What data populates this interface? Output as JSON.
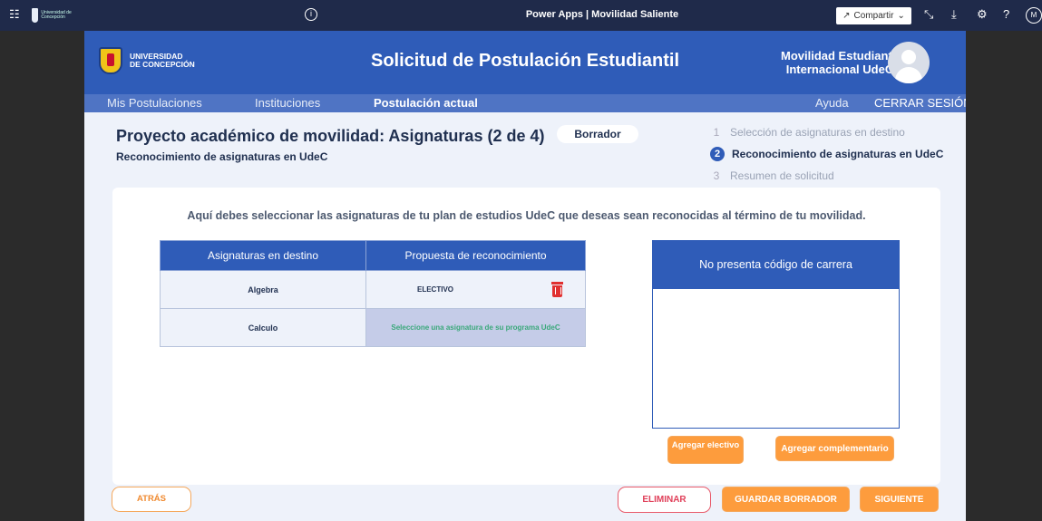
{
  "powerapps_bar": {
    "logo_text": "Universidad de Concepción",
    "title": "Power Apps | Movilidad Saliente",
    "share_label": "Compartir",
    "avatar_initial": "M"
  },
  "header": {
    "logo_line1": "UNIVERSIDAD",
    "logo_line2": "DE CONCEPCIÓN",
    "title": "Solicitud de Postulación Estudiantil",
    "subtitle_line1": "Movilidad Estudiantil",
    "subtitle_line2": "Internacional UdeC"
  },
  "nav": {
    "items": [
      "Mis Postulaciones",
      "Instituciones",
      "Postulación actual"
    ],
    "help": "Ayuda",
    "logout": "CERRAR SESIÓN"
  },
  "page": {
    "title": "Proyecto académico de movilidad: Asignaturas (2 de 4)",
    "subtitle": "Reconocimiento de asignaturas en UdeC",
    "status_badge": "Borrador"
  },
  "steps": [
    {
      "num": "1",
      "label": "Selección de asignaturas en destino"
    },
    {
      "num": "2",
      "label": "Reconocimiento de asignaturas en UdeC"
    },
    {
      "num": "3",
      "label": "Resumen de solicitud"
    }
  ],
  "instruction": "Aquí debes seleccionar las asignaturas de tu plan de estudios UdeC que deseas sean reconocidas al término de tu movilidad.",
  "table": {
    "headers": [
      "Asignaturas en destino",
      "Propuesta de reconocimiento"
    ],
    "rows": [
      {
        "destination": "Algebra",
        "proposal": "ELECTIVO"
      },
      {
        "destination": "Calculo",
        "proposal": "Seleccione una asignatura de su programa UdeC"
      }
    ]
  },
  "career_panel": {
    "title": "No presenta código de carrera"
  },
  "buttons": {
    "add_elective": "Agregar electivo",
    "add_complementary": "Agregar complementario",
    "back": "ATRÁS",
    "delete": "ELIMINAR",
    "save_draft": "GUARDAR BORRADOR",
    "next": "SIGUIENTE"
  },
  "colors": {
    "brand_blue": "#2f5cb8",
    "accent_orange": "#fd9c3d",
    "danger_red": "#e03030"
  }
}
